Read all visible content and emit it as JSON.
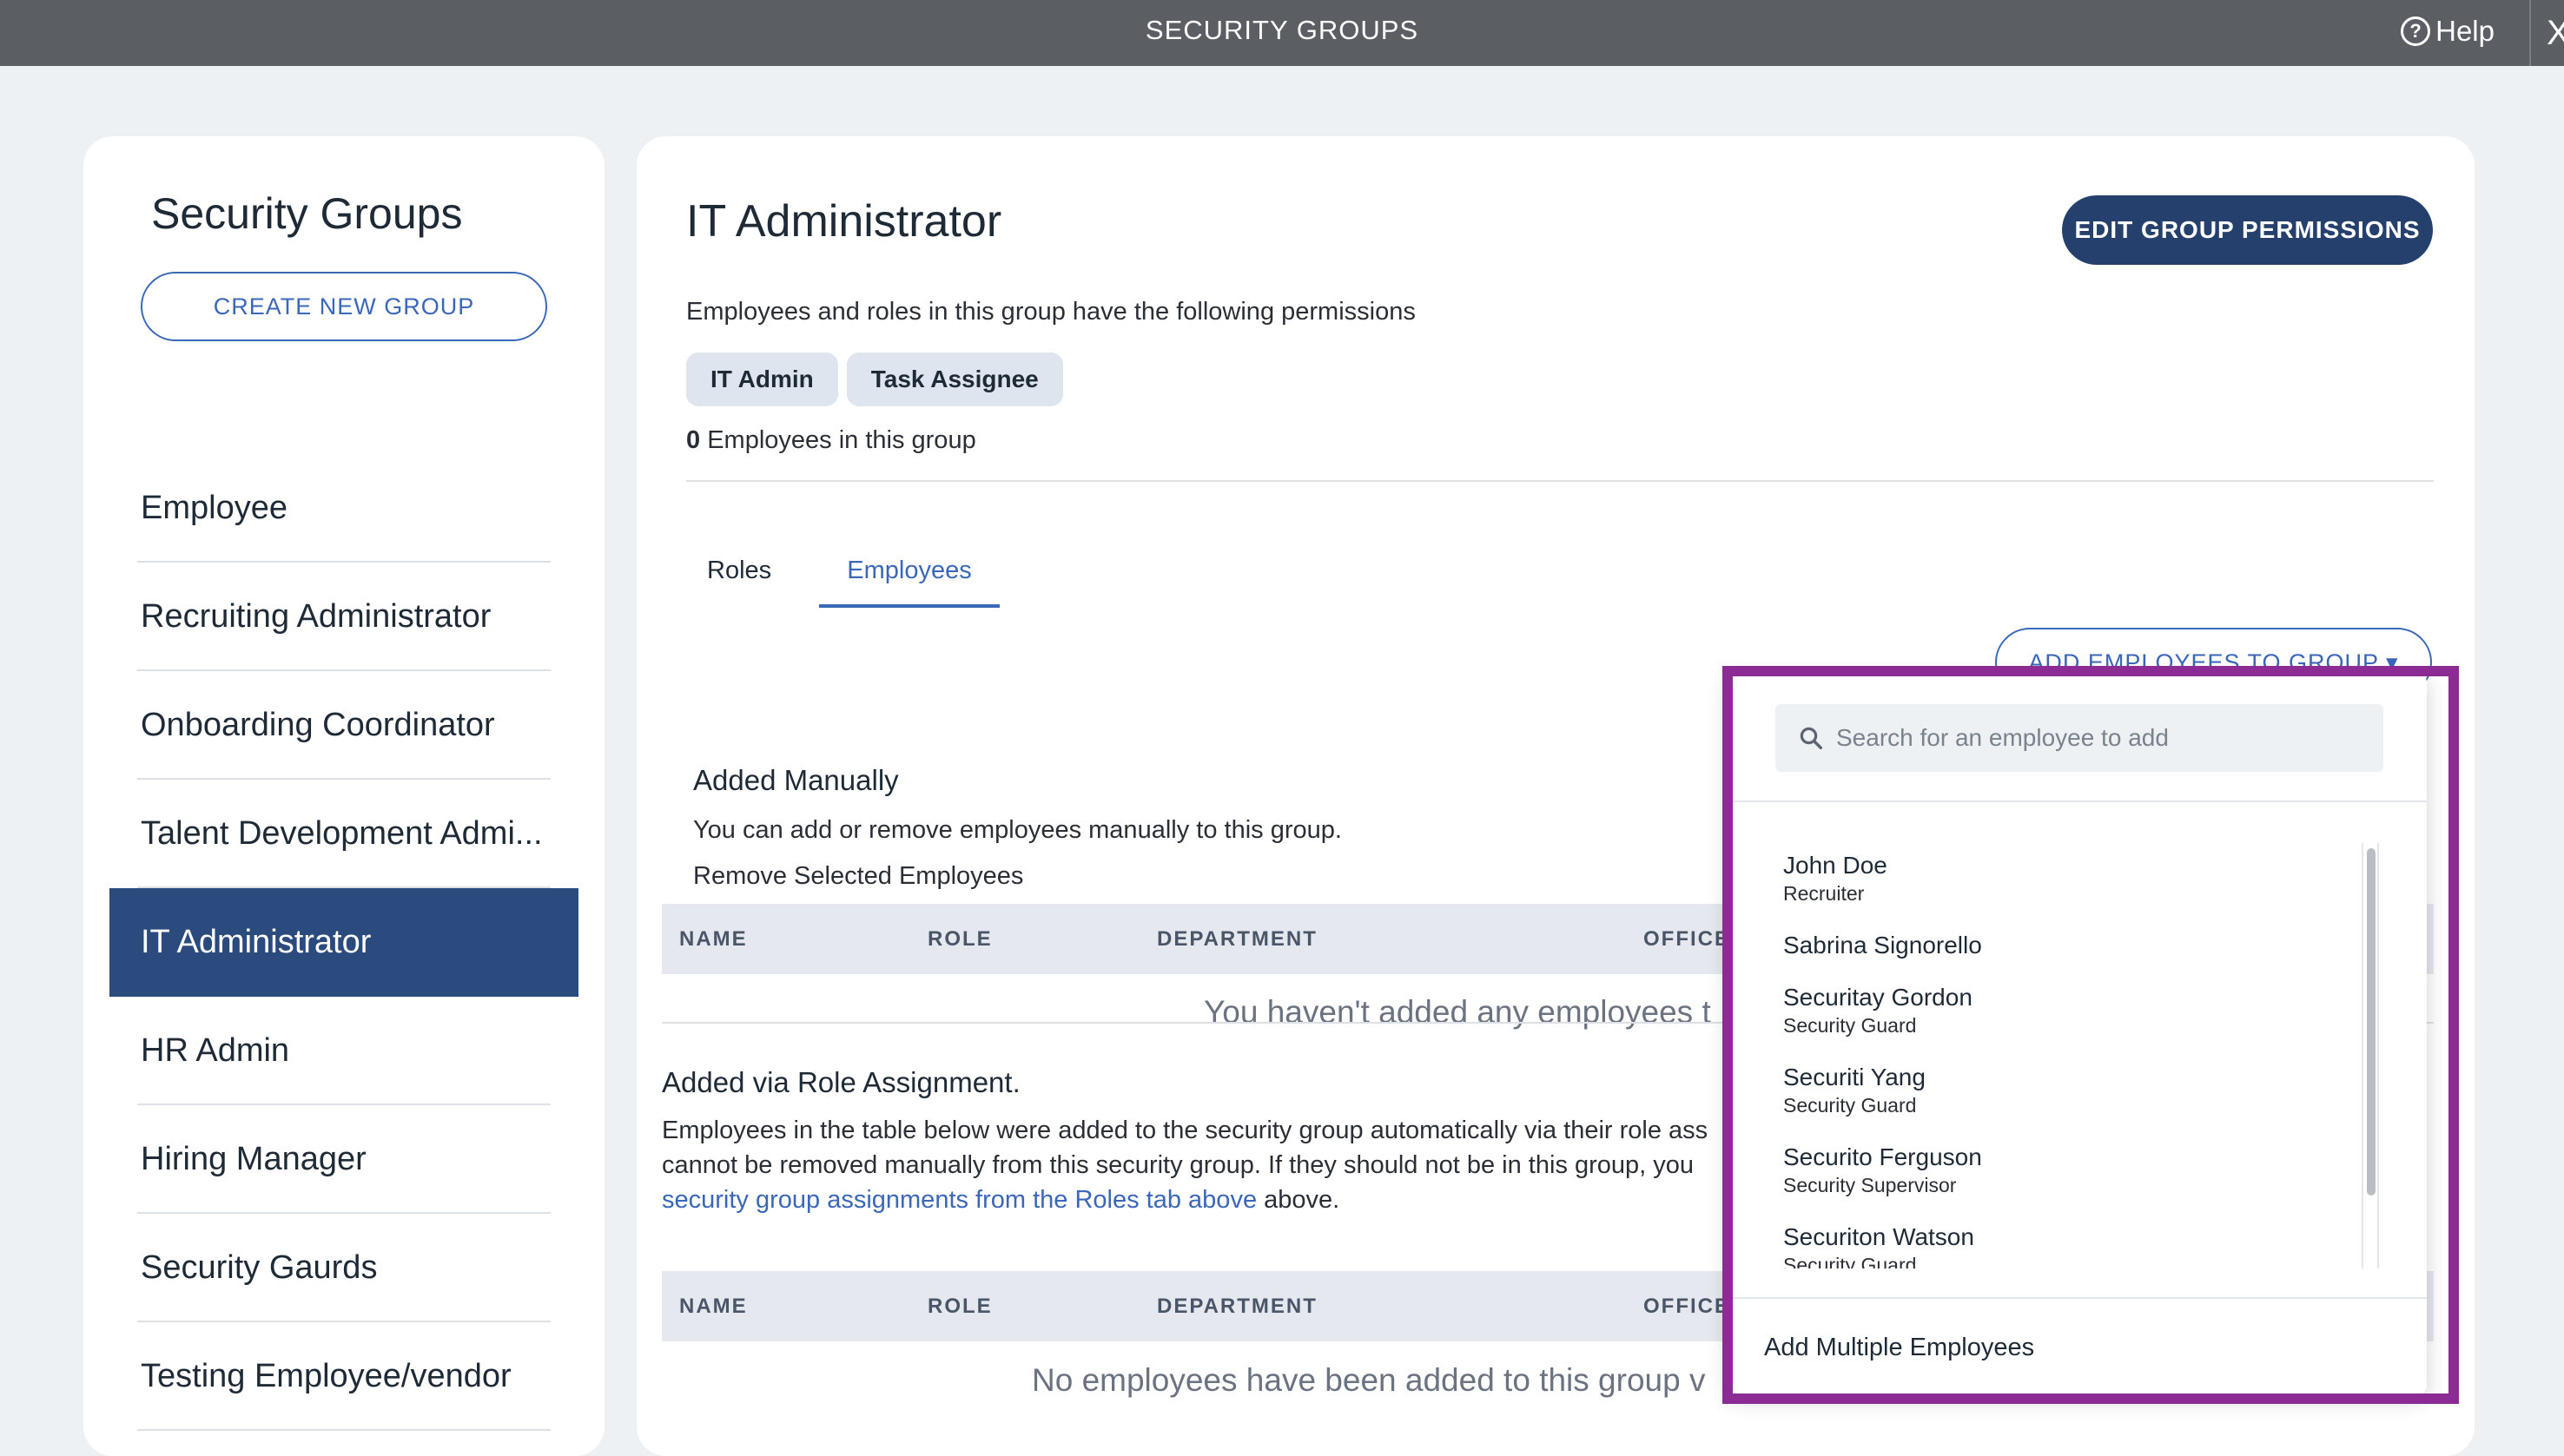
{
  "topbar": {
    "title": "SECURITY GROUPS",
    "help_label": "Help",
    "close_label": "X"
  },
  "sidebar": {
    "title": "Security Groups",
    "create_button": "CREATE NEW GROUP",
    "items": [
      {
        "label": "Employee"
      },
      {
        "label": "Recruiting Administrator"
      },
      {
        "label": "Onboarding Coordinator"
      },
      {
        "label": "Talent Development Admi..."
      },
      {
        "label": "IT Administrator"
      },
      {
        "label": "HR Admin"
      },
      {
        "label": "Hiring Manager"
      },
      {
        "label": "Security Gaurds"
      },
      {
        "label": "Testing Employee/vendor"
      }
    ]
  },
  "main": {
    "title": "IT Administrator",
    "edit_button": "EDIT GROUP PERMISSIONS",
    "permissions_text": "Employees and roles in this group have the following permissions",
    "chips": [
      "IT Admin",
      "Task Assignee"
    ],
    "employee_count": "0",
    "employee_count_suffix": " Employees in this group",
    "tabs": {
      "roles": "Roles",
      "employees": "Employees"
    },
    "manual": {
      "title": "Added Manually",
      "desc": "You can add or remove employees manually to this group.",
      "remove_link": "Remove Selected Employees",
      "add_button": "ADD EMPLOYEES TO GROUP ▾",
      "empty": "You haven't added any employees t"
    },
    "table_headers": [
      "NAME",
      "ROLE",
      "DEPARTMENT",
      "OFFICE"
    ],
    "role_assignment": {
      "title": "Added via Role Assignment.",
      "desc_line1": "Employees in the table below were added to the security group automatically via their role ass",
      "desc_line2": "cannot be removed manually from this security group. If they should not be in this group, you",
      "desc_link": "security group assignments from the Roles tab above",
      "desc_after": " above.",
      "empty": "No employees have been added to this group v"
    }
  },
  "dropdown": {
    "search_placeholder": "Search for an employee to add",
    "employees": [
      {
        "name": "John Doe",
        "role": "Recruiter"
      },
      {
        "name": "Sabrina Signorello",
        "role": ""
      },
      {
        "name": "Securitay Gordon",
        "role": "Security Guard"
      },
      {
        "name": "Securiti Yang",
        "role": "Security Guard"
      },
      {
        "name": "Securito Ferguson",
        "role": "Security Supervisor"
      },
      {
        "name": "Securiton Watson",
        "role": "Security Guard"
      }
    ],
    "add_multiple": "Add Multiple Employees"
  }
}
